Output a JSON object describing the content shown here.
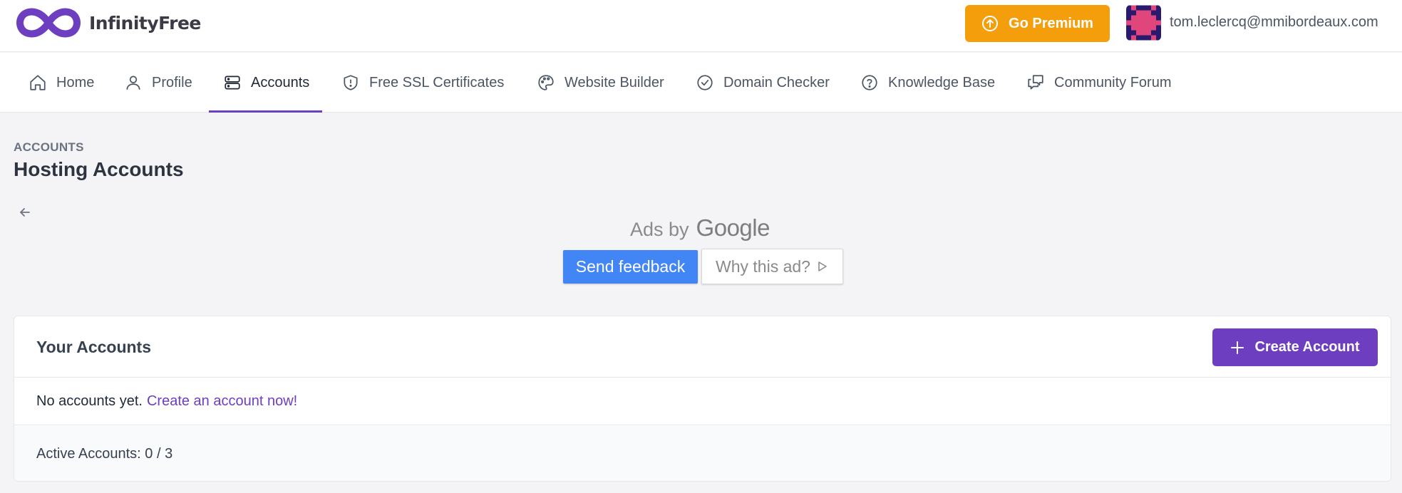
{
  "brand": {
    "name": "InfinityFree",
    "accent": "#6d3fc0"
  },
  "header": {
    "premium_label": "Go Premium",
    "premium_color": "#f59e0b",
    "user_email": "tom.leclercq@mmibordeaux.com"
  },
  "nav": {
    "items": [
      {
        "label": "Home",
        "icon": "home-icon"
      },
      {
        "label": "Profile",
        "icon": "user-icon"
      },
      {
        "label": "Accounts",
        "icon": "server-icon",
        "active": true
      },
      {
        "label": "Free SSL Certificates",
        "icon": "shield-icon"
      },
      {
        "label": "Website Builder",
        "icon": "palette-icon"
      },
      {
        "label": "Domain Checker",
        "icon": "check-circle-icon"
      },
      {
        "label": "Knowledge Base",
        "icon": "question-circle-icon"
      },
      {
        "label": "Community Forum",
        "icon": "chat-icon"
      }
    ]
  },
  "page": {
    "eyebrow": "ACCOUNTS",
    "title": "Hosting Accounts"
  },
  "ad": {
    "ads_by": "Ads by",
    "google": "Google",
    "send_feedback": "Send feedback",
    "why_this_ad": "Why this ad?"
  },
  "accounts_card": {
    "title": "Your Accounts",
    "create_label": "Create Account",
    "empty_text": "No accounts yet.",
    "empty_link": "Create an account now!",
    "active_accounts": "Active Accounts: 0 / 3"
  }
}
